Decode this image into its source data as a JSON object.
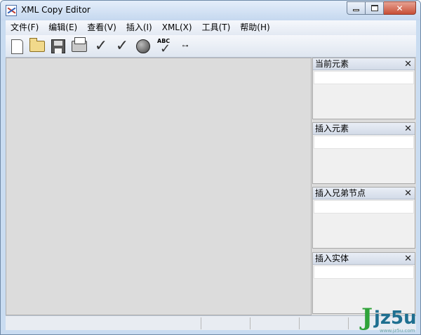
{
  "window": {
    "title": "XML Copy Editor",
    "controls": {
      "minimize": "minimize-icon",
      "maximize": "maximize-icon",
      "close": "✕"
    }
  },
  "menu": [
    "文件(F)",
    "编辑(E)",
    "查看(V)",
    "插入(I)",
    "XML(X)",
    "工具(T)",
    "帮助(H)"
  ],
  "toolbar": {
    "icons": [
      "new-document-icon",
      "open-folder-icon",
      "save-icon",
      "print-icon",
      "check-wellformed-icon",
      "validate-icon",
      "browser-icon",
      "spellcheck-icon",
      "xml-icon"
    ],
    "spellcheck_text": "ABC",
    "xml_text": "⊶"
  },
  "panes": [
    {
      "title": "当前元素",
      "close": "✕"
    },
    {
      "title": "插入元素",
      "close": "✕"
    },
    {
      "title": "插入兄弟节点",
      "close": "✕"
    },
    {
      "title": "插入实体",
      "close": "✕"
    }
  ],
  "watermark": {
    "j": "J",
    "text": "jz5u",
    "sub": "www.jz5u.com"
  }
}
